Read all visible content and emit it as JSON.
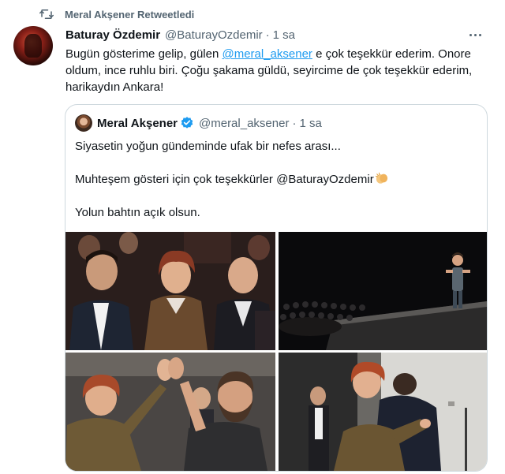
{
  "retweet": {
    "label": "Meral Akşener Retweetledi",
    "icon": "retweet-icon"
  },
  "tweet": {
    "author_name": "Baturay Özdemir",
    "author_handle": "@BaturayOzdemir",
    "separator": "·",
    "time": "1 sa",
    "text_before": "Bugün gösterime gelip, gülen ",
    "mention": "@meral_aksener",
    "text_after": " e çok teşekkür ederim. Onore oldum, ince ruhlu biri. Çoğu şakama güldü, seyircime de çok teşekkür ederim, harikaydın Ankara!"
  },
  "quote": {
    "author_name": "Meral Akşener",
    "author_handle": "@meral_aksener",
    "separator": "·",
    "time": "1 sa",
    "line1": "Siyasetin yoğun gündeminde ufak bir nefes arası...",
    "line2": "Muhteşem gösteri için çok teşekkürler @BaturayOzdemir",
    "line3": "Yolun bahtın açık olsun."
  },
  "colors": {
    "text": "#0f1419",
    "secondary": "#536471",
    "link": "#1d9bf0",
    "border": "#cfd9de",
    "verified": "#1d9bf0"
  }
}
